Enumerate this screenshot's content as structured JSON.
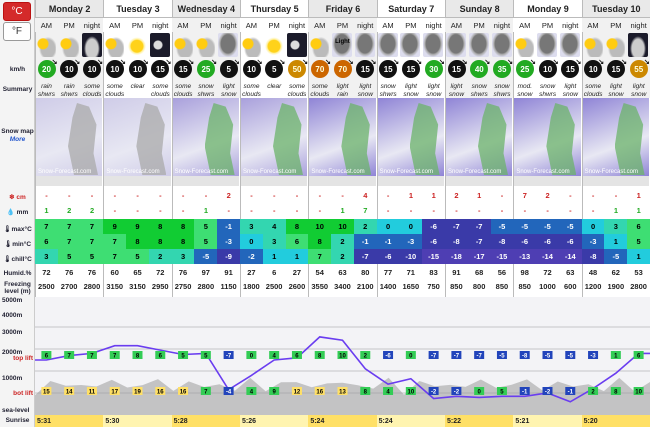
{
  "units": {
    "celsius": "°C",
    "fahrenheit": "°F"
  },
  "row_labels": {
    "wind": "km/h",
    "summary": "Summary",
    "snowmap": "Snow map",
    "snowmap_more": "More",
    "snow": "cm",
    "rain": "mm",
    "max": "max°C",
    "min": "min°C",
    "chill": "chill°C",
    "humid": "Humid.%",
    "freezing": "Freezing level (m)",
    "alt_5000": "5000m",
    "alt_4000": "4000m",
    "alt_3000": "3000m",
    "alt_2000": "2000m",
    "top_lift": "top lift",
    "alt_1000": "1000m",
    "bot_lift": "bot lift",
    "sea_level": "sea-level",
    "sunrise": "Sunrise"
  },
  "days": [
    {
      "name": "Monday 2",
      "cols": 3
    },
    {
      "name": "Tuesday 3",
      "cols": 3
    },
    {
      "name": "Wednesday 4",
      "cols": 3
    },
    {
      "name": "Thursday 5",
      "cols": 3
    },
    {
      "name": "Friday 6",
      "cols": 3
    },
    {
      "name": "Saturday 7",
      "cols": 3
    },
    {
      "name": "Sunday 8",
      "cols": 3
    },
    {
      "name": "Monday 9",
      "cols": 3
    },
    {
      "name": "Tuesday 10",
      "cols": 3
    }
  ],
  "periods": [
    "AM",
    "PM",
    "night",
    "AM",
    "PM",
    "night",
    "AM",
    "PM",
    "night",
    "AM",
    "PM",
    "night",
    "AM",
    "PM",
    "night",
    "AM",
    "PM",
    "night",
    "AM",
    "PM",
    "night",
    "AM",
    "PM",
    "night",
    "AM",
    "PM",
    "night"
  ],
  "icons": [
    "sun-cloud",
    "sun-cloud",
    "moon-cloud",
    "sun-cloud",
    "sun",
    "moon",
    "sun-cloud",
    "sun-cloud",
    "snow-cloud",
    "sun-cloud",
    "sun",
    "moon",
    "sun-cloud",
    "snow-cloud",
    "snow-cloud",
    "snow-cloud",
    "snow-cloud",
    "snow-cloud",
    "snow-cloud",
    "snow-cloud",
    "snow-cloud",
    "sun-cloud",
    "snow-cloud",
    "snow-cloud",
    "sun-cloud",
    "sun-cloud",
    "moon-cloud"
  ],
  "icon_text": {
    "13": "Light"
  },
  "wind": [
    20,
    10,
    10,
    10,
    10,
    15,
    15,
    25,
    5,
    10,
    5,
    50,
    70,
    70,
    15,
    15,
    15,
    30,
    15,
    40,
    35,
    25,
    10,
    15,
    10,
    15,
    55
  ],
  "wind_colors": [
    "#2a2",
    "#111",
    "#111",
    "#111",
    "#111",
    "#111",
    "#111",
    "#2a2",
    "#111",
    "#111",
    "#111",
    "#c80",
    "#c60",
    "#c60",
    "#111",
    "#111",
    "#111",
    "#2a2",
    "#111",
    "#2a2",
    "#2a2",
    "#2a2",
    "#111",
    "#111",
    "#111",
    "#111",
    "#c80"
  ],
  "summary": [
    "rain shwrs",
    "rain shwrs",
    "some clouds",
    "some clouds",
    "clear",
    "some clouds",
    "some clouds",
    "snow shwrs",
    "light snow",
    "some clouds",
    "clear",
    "some clouds",
    "some clouds",
    "light rain",
    "light snow",
    "snow shwrs",
    "light snow",
    "light snow",
    "light snow",
    "snow shwrs",
    "snow shwrs",
    "mod. snow",
    "snow shwrs",
    "light snow",
    "some clouds",
    "light snow",
    "light snow"
  ],
  "snowmap_watermark": "Snow-Forecast.com",
  "snow": [
    "-",
    "-",
    "-",
    "-",
    "-",
    "-",
    "-",
    "-",
    "2",
    "-",
    "-",
    "-",
    "-",
    "-",
    "4",
    "-",
    "1",
    "1",
    "2",
    "1",
    "-",
    "7",
    "2",
    "-",
    "-",
    "-",
    "1"
  ],
  "rain": [
    "1",
    "2",
    "2",
    "-",
    "-",
    "-",
    "-",
    "1",
    "-",
    "-",
    "-",
    "-",
    "-",
    "1",
    "7",
    "-",
    "-",
    "-",
    "-",
    "-",
    "-",
    "-",
    "-",
    "-",
    "-",
    "1",
    "1"
  ],
  "max": [
    7,
    7,
    7,
    9,
    9,
    8,
    8,
    5,
    -1,
    3,
    4,
    8,
    10,
    10,
    2,
    0,
    0,
    -6,
    -7,
    -7,
    -5,
    -5,
    -5,
    -5,
    0,
    3,
    6
  ],
  "min": [
    6,
    7,
    7,
    7,
    8,
    8,
    8,
    5,
    -3,
    0,
    3,
    6,
    8,
    2,
    -1,
    -1,
    -3,
    -6,
    -8,
    -7,
    -8,
    -6,
    -6,
    -6,
    -3,
    1,
    5
  ],
  "chill": [
    3,
    5,
    5,
    7,
    5,
    2,
    3,
    -5,
    -9,
    -2,
    1,
    1,
    7,
    2,
    -7,
    -6,
    -10,
    -15,
    -18,
    -17,
    -15,
    -13,
    -14,
    -14,
    -8,
    -5,
    1
  ],
  "humid": [
    72,
    76,
    76,
    60,
    65,
    72,
    76,
    97,
    91,
    27,
    6,
    27,
    54,
    63,
    80,
    77,
    71,
    83,
    91,
    68,
    56,
    98,
    72,
    63,
    48,
    62,
    53
  ],
  "freezing": [
    2500,
    2700,
    2800,
    3150,
    3150,
    2950,
    2750,
    2800,
    1150,
    1800,
    2500,
    2600,
    3550,
    3400,
    2100,
    1400,
    1650,
    750,
    850,
    800,
    850,
    850,
    1000,
    600,
    1200,
    1900,
    2800
  ],
  "level_top": [
    6,
    7,
    7,
    7,
    8,
    6,
    5,
    5,
    -7,
    0,
    4,
    6,
    8,
    10,
    2,
    -6,
    0,
    -7,
    -7,
    -7,
    -5,
    -8,
    -5,
    -5,
    -3,
    1,
    6
  ],
  "level_bot": [
    15,
    14,
    11,
    17,
    19,
    16,
    16,
    7,
    -4,
    4,
    9,
    12,
    16,
    13,
    8,
    4,
    10,
    -2,
    -2,
    0,
    5,
    -1,
    -2,
    -1,
    2,
    8,
    10
  ],
  "sunrise": [
    "5:31",
    "5:30",
    "5:28",
    "5:26",
    "5:24",
    "5:24",
    "5:22",
    "5:21",
    "5:20"
  ],
  "colors": {
    "accent": "#d42a2a",
    "hot": "#22aa44",
    "warm": "#22cc66",
    "cool": "#1ad0e0",
    "cold": "#2255aa",
    "vcold": "#4b3db0"
  }
}
